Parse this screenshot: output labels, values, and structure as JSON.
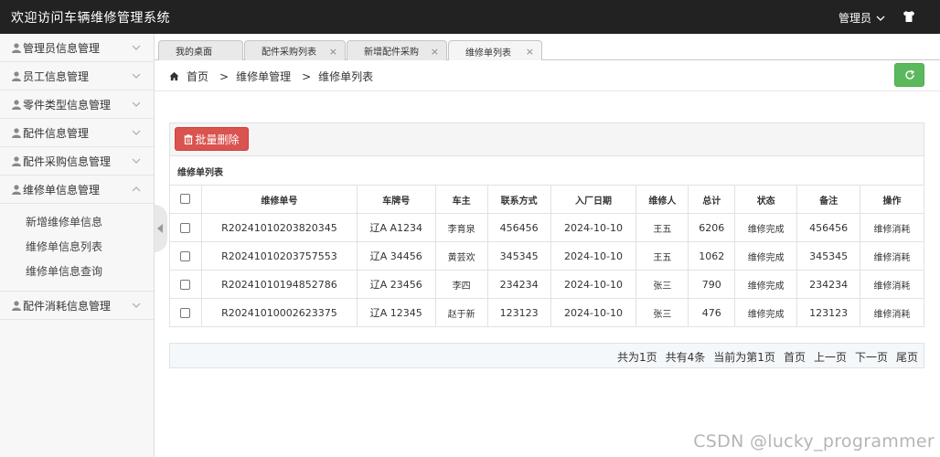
{
  "app": {
    "title": "欢迎访问车辆维修管理系统",
    "user_label": "管理员"
  },
  "sidebar": {
    "items": [
      {
        "label": "管理员信息管理"
      },
      {
        "label": "员工信息管理"
      },
      {
        "label": "零件类型信息管理"
      },
      {
        "label": "配件信息管理"
      },
      {
        "label": "配件采购信息管理"
      },
      {
        "label": "维修单信息管理"
      },
      {
        "label": "配件消耗信息管理"
      }
    ],
    "sub_items": [
      {
        "label": "新增维修单信息"
      },
      {
        "label": "维修单信息列表"
      },
      {
        "label": "维修单信息查询"
      }
    ]
  },
  "tabs": [
    {
      "label": "我的桌面"
    },
    {
      "label": "配件采购列表",
      "close": "×"
    },
    {
      "label": "新增配件采购",
      "close": "×"
    },
    {
      "label": "维修单列表",
      "close": "×"
    }
  ],
  "breadcrumb": {
    "home": "首页",
    "sep1": ">",
    "section": "维修单管理",
    "sep2": ">",
    "page": "维修单列表"
  },
  "toolbar": {
    "delete_label": "批量删除"
  },
  "list": {
    "title": "维修单列表",
    "columns": [
      "维修单号",
      "车牌号",
      "车主",
      "联系方式",
      "入厂日期",
      "维修人",
      "总计",
      "状态",
      "备注",
      "操作"
    ],
    "rows": [
      {
        "order_no": "R20241010203820345",
        "plate": "辽A A1234",
        "owner": "李育泉",
        "phone": "456456",
        "date": "2024-10-10",
        "repairer": "王五",
        "total": "6206",
        "status": "维修完成",
        "note": "456456",
        "action": "维修消耗"
      },
      {
        "order_no": "R20241010203757553",
        "plate": "辽A 34456",
        "owner": "黄芸欢",
        "phone": "345345",
        "date": "2024-10-10",
        "repairer": "王五",
        "total": "1062",
        "status": "维修完成",
        "note": "345345",
        "action": "维修消耗"
      },
      {
        "order_no": "R20241010194852786",
        "plate": "辽A 23456",
        "owner": "李四",
        "phone": "234234",
        "date": "2024-10-10",
        "repairer": "张三",
        "total": "790",
        "status": "维修完成",
        "note": "234234",
        "action": "维修消耗"
      },
      {
        "order_no": "R20241010002623375",
        "plate": "辽A 12345",
        "owner": "赵于新",
        "phone": "123123",
        "date": "2024-10-10",
        "repairer": "张三",
        "total": "476",
        "status": "维修完成",
        "note": "123123",
        "action": "维修消耗"
      }
    ]
  },
  "pager": {
    "total_pages": "共为1页",
    "total_items": "共有4条",
    "current": "当前为第1页",
    "first": "首页",
    "prev": "上一页",
    "next": "下一页",
    "last": "尾页"
  },
  "watermark": "CSDN @lucky_programmer",
  "colors": {
    "topbar": "#222222",
    "danger": "#d9534f",
    "success": "#5cb85c"
  },
  "icons": {
    "user_menu": "chevron-down-icon",
    "header_right": "shirt-icon",
    "menu": "user-icon",
    "home": "home-icon",
    "refresh": "refresh-icon",
    "delete": "trash-icon"
  }
}
